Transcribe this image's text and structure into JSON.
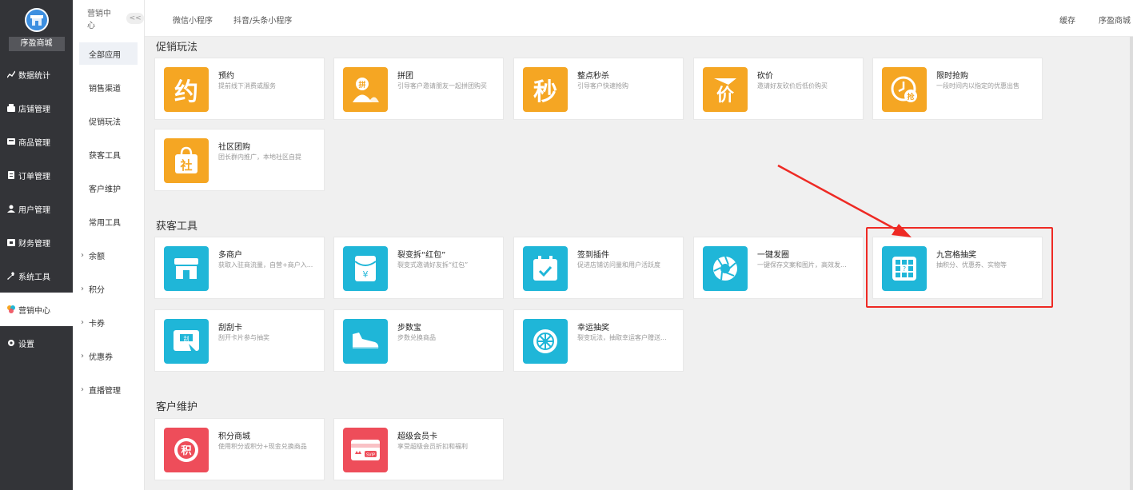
{
  "sidebar": {
    "shop_name": "序盈商城",
    "items": [
      {
        "label": "数据统计",
        "icon": "chart-icon"
      },
      {
        "label": "店铺管理",
        "icon": "shop-icon"
      },
      {
        "label": "商品管理",
        "icon": "goods-icon"
      },
      {
        "label": "订单管理",
        "icon": "order-icon"
      },
      {
        "label": "用户管理",
        "icon": "user-icon"
      },
      {
        "label": "财务管理",
        "icon": "finance-icon"
      },
      {
        "label": "系统工具",
        "icon": "wrench-icon"
      },
      {
        "label": "营销中心",
        "icon": "marketing-icon"
      },
      {
        "label": "设置",
        "icon": "gear-icon"
      }
    ]
  },
  "subnav": {
    "title": "营销中心",
    "collapse": "<<",
    "items": [
      "全部应用",
      "销售渠道",
      "促销玩法",
      "获客工具",
      "客户维护",
      "常用工具"
    ],
    "expand_items": [
      "余额",
      "积分",
      "卡券",
      "优惠券",
      "直播管理"
    ]
  },
  "topbar": {
    "tabs": [
      "微信小程序",
      "抖音/头条小程序"
    ],
    "right": [
      "缓存",
      "序盈商城"
    ]
  },
  "sections": [
    {
      "title": "促销玩法",
      "cards": [
        {
          "name": "预约",
          "desc": "提前线下消费或服务",
          "glyph": "约",
          "color": "#f5a623",
          "icon": "appointment-icon"
        },
        {
          "name": "拼团",
          "desc": "引导客户邀请朋友一起拼团购买",
          "glyph": "拼",
          "color": "#f5a623",
          "icon": "group-buy-icon"
        },
        {
          "name": "整点秒杀",
          "desc": "引导客户快速抢购",
          "glyph": "秒",
          "color": "#f5a623",
          "icon": "flash-sale-icon"
        },
        {
          "name": "砍价",
          "desc": "邀请好友砍价后低价购买",
          "glyph": "价",
          "color": "#f5a623",
          "icon": "bargain-icon"
        },
        {
          "name": "限时抢购",
          "desc": "一段时间内以指定的优惠出售",
          "glyph": "抢",
          "color": "#f5a623",
          "icon": "limited-time-icon"
        },
        {
          "name": "社区团购",
          "desc": "团长群内推广，本地社区自提",
          "glyph": "社",
          "color": "#f5a623",
          "icon": "community-icon"
        }
      ]
    },
    {
      "title": "获客工具",
      "cards": [
        {
          "name": "多商户",
          "desc": "获取入驻商流量，自营+商户入...",
          "glyph": "",
          "color": "#1fb6d8",
          "icon": "store-icon"
        },
        {
          "name": "裂变拆“红包”",
          "desc": "裂变式邀请好友拆“红包”",
          "glyph": "¥",
          "color": "#1fb6d8",
          "icon": "red-packet-icon"
        },
        {
          "name": "签到插件",
          "desc": "促进店铺访问量和用户活跃度",
          "glyph": "✓",
          "color": "#1fb6d8",
          "icon": "checkin-icon"
        },
        {
          "name": "一键发圈",
          "desc": "一键保存文案和图片，高效发...",
          "glyph": "",
          "color": "#1fb6d8",
          "icon": "aperture-icon"
        },
        {
          "name": "九宫格抽奖",
          "desc": "抽积分、优惠券、实物等",
          "glyph": "",
          "color": "#1fb6d8",
          "icon": "grid-lottery-icon"
        },
        {
          "name": "刮刮卡",
          "desc": "刮开卡片参与抽奖",
          "glyph": "刮",
          "color": "#1fb6d8",
          "icon": "scratch-card-icon"
        },
        {
          "name": "步数宝",
          "desc": "步数兑换商品",
          "glyph": "",
          "color": "#1fb6d8",
          "icon": "shoe-icon"
        },
        {
          "name": "幸运抽奖",
          "desc": "裂变玩法，抽取幸运客户赠送...",
          "glyph": "",
          "color": "#1fb6d8",
          "icon": "wheel-icon"
        }
      ]
    },
    {
      "title": "客户维护",
      "cards": [
        {
          "name": "积分商城",
          "desc": "使用积分或积分+现金兑换商品",
          "glyph": "积",
          "color": "#ee4d5a",
          "icon": "points-mall-icon"
        },
        {
          "name": "超级会员卡",
          "desc": "享受超级会员折扣和福利",
          "glyph": "SVIP",
          "color": "#ee4d5a",
          "icon": "vip-card-icon"
        }
      ]
    }
  ]
}
